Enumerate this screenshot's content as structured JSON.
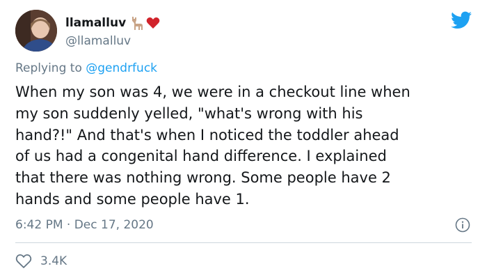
{
  "user": {
    "display_name": "llamalluv",
    "handle": "@llamalluv",
    "emojis": [
      "llama-icon",
      "red-heart-icon"
    ]
  },
  "reply": {
    "prefix": "Replying to ",
    "mention": "@gendrfuck"
  },
  "tweet": {
    "text": "When my son was 4, we were in a checkout line when\nmy son suddenly yelled, \"what's wrong with his\nhand?!\" And that's when I noticed the toddler ahead\nof us had a congenital hand difference. I explained\nthat there was nothing wrong. Some people have 2\nhands and some people have 1.",
    "timestamp": "6:42 PM · Dec 17, 2020"
  },
  "stats": {
    "likes": "3.4K"
  },
  "colors": {
    "twitter_blue": "#1da1f2",
    "secondary_text": "#657786",
    "heart_red": "#d1232b"
  }
}
